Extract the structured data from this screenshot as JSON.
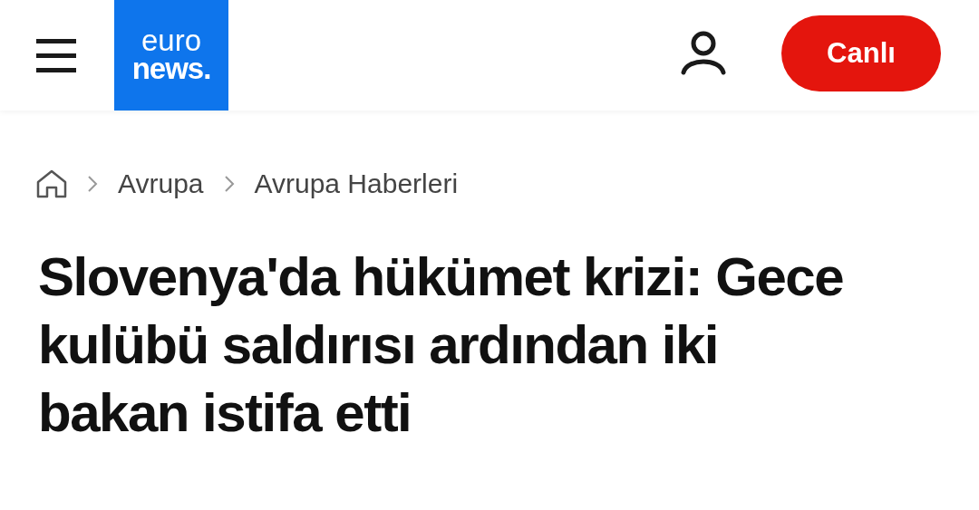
{
  "header": {
    "logo": {
      "top": "euro",
      "bottom": "news."
    },
    "live_button": "Canlı"
  },
  "breadcrumb": [
    "Avrupa",
    "Avrupa Haberleri"
  ],
  "headline": "Slovenya'da hükümet krizi: Gece kulübü saldırısı ardından iki bakan istifa etti"
}
